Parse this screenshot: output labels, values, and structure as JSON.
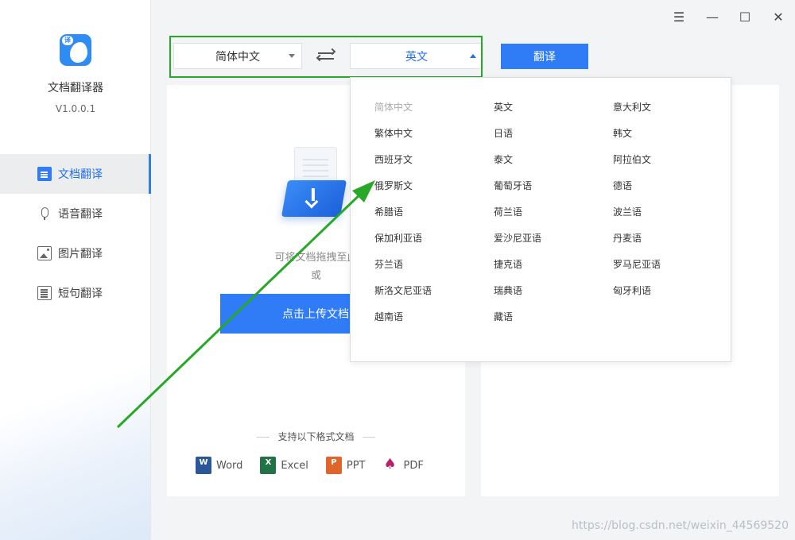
{
  "app": {
    "name": "文档翻译器",
    "version": "V1.0.0.1",
    "logo_badge": "译"
  },
  "sidebar": {
    "items": [
      {
        "label": "文档翻译",
        "icon": "document-icon",
        "active": true
      },
      {
        "label": "语音翻译",
        "icon": "microphone-icon",
        "active": false
      },
      {
        "label": "图片翻译",
        "icon": "image-icon",
        "active": false
      },
      {
        "label": "短句翻译",
        "icon": "list-icon",
        "active": false
      }
    ]
  },
  "window_controls": {
    "menu": "☰",
    "minimize": "—",
    "maximize": "☐",
    "close": "✕"
  },
  "toolbar": {
    "source_lang": "简体中文",
    "target_lang": "英文",
    "translate_label": "翻译"
  },
  "upload": {
    "hint": "可将文档拖拽至此",
    "or": "或",
    "button_label": "点击上传文档",
    "formats_title": "支持以下格式文档",
    "formats": [
      {
        "label": "Word",
        "icon": "word-icon",
        "badge": "W"
      },
      {
        "label": "Excel",
        "icon": "excel-icon",
        "badge": "X"
      },
      {
        "label": "PPT",
        "icon": "ppt-icon",
        "badge": "P"
      },
      {
        "label": "PDF",
        "icon": "pdf-icon",
        "badge": ""
      }
    ]
  },
  "dropdown": {
    "columns": [
      [
        "简体中文",
        "繁体中文",
        "西班牙文",
        "俄罗斯文",
        "希腊语",
        "保加利亚语",
        "芬兰语",
        "斯洛文尼亚语",
        "越南语"
      ],
      [
        "英文",
        "日语",
        "泰文",
        "葡萄牙语",
        "荷兰语",
        "爱沙尼亚语",
        "捷克语",
        "瑞典语",
        "藏语"
      ],
      [
        "意大利文",
        "韩文",
        "阿拉伯文",
        "德语",
        "波兰语",
        "丹麦语",
        "罗马尼亚语",
        "匈牙利语"
      ]
    ],
    "disabled": "简体中文"
  },
  "colors": {
    "accent": "#2f7cf6",
    "highlight": "#28a828"
  },
  "watermark": "https://blog.csdn.net/weixin_44569520"
}
